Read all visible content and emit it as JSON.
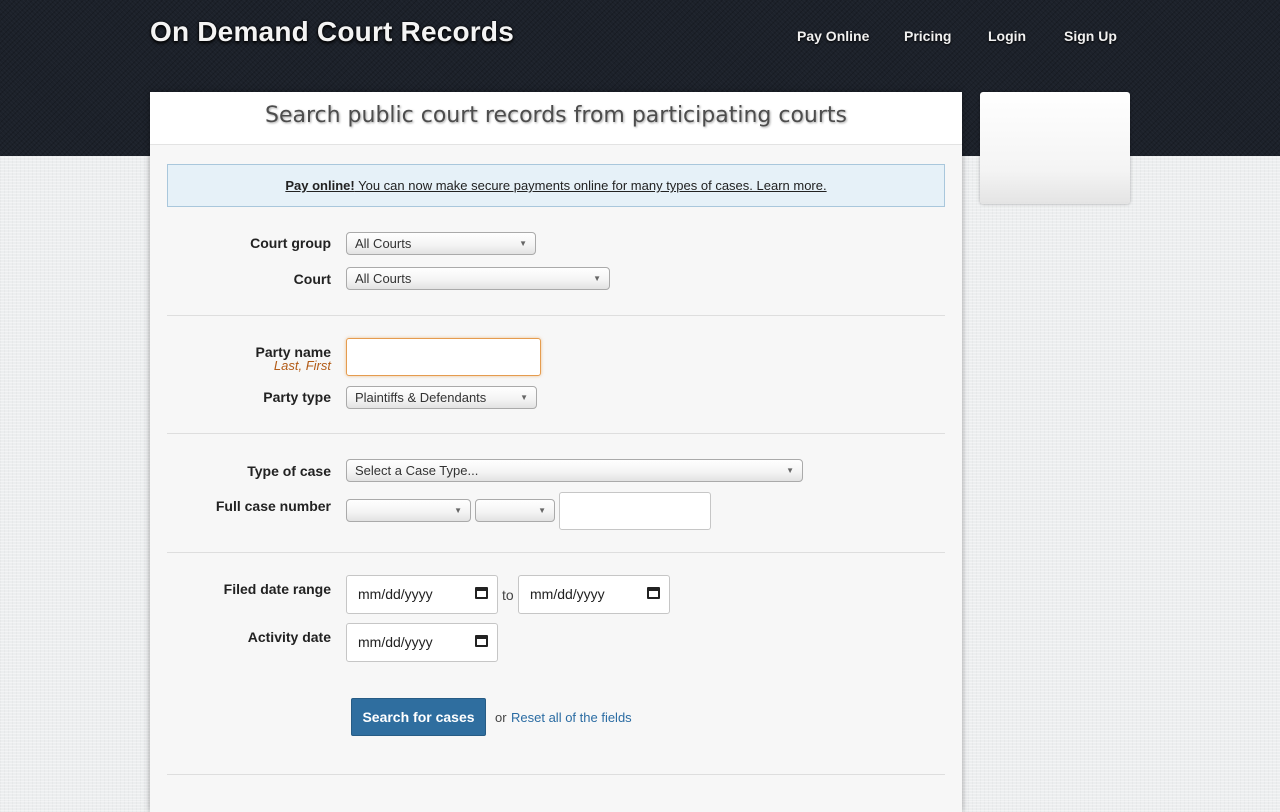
{
  "header": {
    "site_title": "On Demand Court Records",
    "nav": [
      "Pay Online",
      "Pricing",
      "Login",
      "Sign Up"
    ]
  },
  "panel": {
    "heading": "Search public court records from participating courts"
  },
  "notice": {
    "strong": "Pay online!",
    "text": " You can now make secure payments online for many types of cases. Learn more."
  },
  "form": {
    "court_group_label": "Court group",
    "court_group_value": "All Courts",
    "court_label": "Court",
    "court_value": "All Courts",
    "party_name_label": "Party name",
    "party_name_hint": "Last, First",
    "party_name_value": "",
    "party_type_label": "Party type",
    "party_type_value": "Plaintiffs & Defendants",
    "case_type_label": "Type of case",
    "case_type_value": "Select a Case Type...",
    "case_number_label": "Full case number",
    "case_number_value": "",
    "filed_date_label": "Filed date range",
    "date_placeholder": "mm/dd/yyyy",
    "to_label": "to",
    "activity_date_label": "Activity date",
    "search_button": "Search for cases",
    "or_text": "or",
    "reset_link": "Reset all of the fields"
  },
  "icons": {
    "dropdown": "chevron-down-icon",
    "date": "calendar-icon"
  }
}
